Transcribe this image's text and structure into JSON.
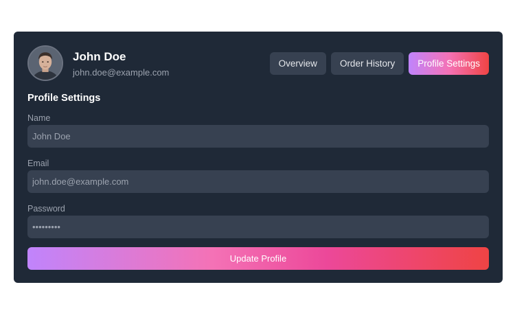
{
  "user": {
    "name": "John Doe",
    "email": "john.doe@example.com"
  },
  "tabs": [
    {
      "label": "Overview",
      "active": false
    },
    {
      "label": "Order History",
      "active": false
    },
    {
      "label": "Profile Settings",
      "active": true
    }
  ],
  "form": {
    "title": "Profile Settings",
    "fields": {
      "name": {
        "label": "Name",
        "value": "John Doe"
      },
      "email": {
        "label": "Email",
        "value": "john.doe@example.com"
      },
      "password": {
        "label": "Password",
        "value": "password1"
      }
    },
    "submit_label": "Update Profile"
  },
  "colors": {
    "card_background": "#1f2937",
    "input_background": "#374151",
    "gradient_start": "#c084fc",
    "gradient_end": "#ef4444"
  },
  "icons": {
    "avatar": "user-avatar-photo"
  }
}
